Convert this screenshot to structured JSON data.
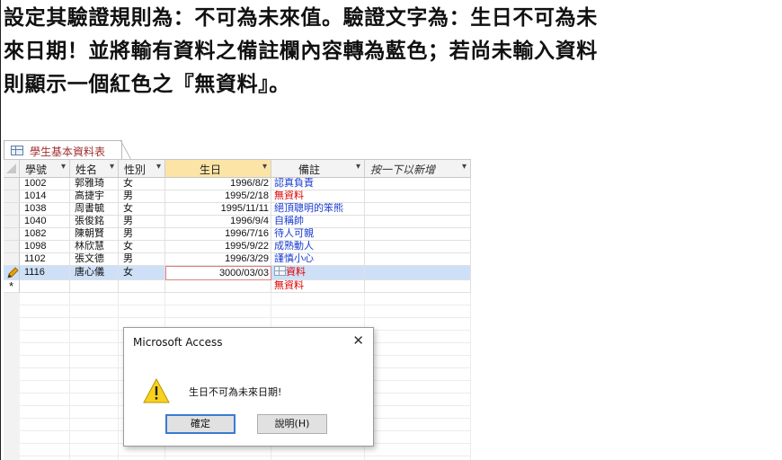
{
  "instruction": {
    "lines": [
      "設定其驗證規則為：不可為未來值。驗證文字為：生日不可為未",
      "來日期！並將輸有資料之備註欄內容轉為藍色；若尚未輸入資料",
      "則顯示一個紅色之『無資料』。"
    ]
  },
  "table": {
    "tab_label": "學生基本資料表",
    "columns": [
      {
        "label": "學號"
      },
      {
        "label": "姓名"
      },
      {
        "label": "性別"
      },
      {
        "label": "生日"
      },
      {
        "label": "備註"
      },
      {
        "label": "按一下以新增"
      }
    ],
    "rows": [
      {
        "id": "1002",
        "name": "郭雅琦",
        "sex": "女",
        "birthday": "1996/8/2",
        "note": "認真負責"
      },
      {
        "id": "1014",
        "name": "高捷宇",
        "sex": "男",
        "birthday": "1995/2/18",
        "note": "無資料"
      },
      {
        "id": "1038",
        "name": "周書毓",
        "sex": "女",
        "birthday": "1995/11/11",
        "note": "絕頂聰明的笨熊"
      },
      {
        "id": "1040",
        "name": "張俊銘",
        "sex": "男",
        "birthday": "1996/9/4",
        "note": "自稱帥"
      },
      {
        "id": "1082",
        "name": "陳朝賢",
        "sex": "男",
        "birthday": "1996/7/16",
        "note": "待人可親"
      },
      {
        "id": "1098",
        "name": "林欣慧",
        "sex": "女",
        "birthday": "1995/9/22",
        "note": "成熟動人"
      },
      {
        "id": "1102",
        "name": "張文德",
        "sex": "男",
        "birthday": "1996/3/29",
        "note": "謹慎小心"
      },
      {
        "id": "1116",
        "name": "唐心儀",
        "sex": "女",
        "birthday": "3000/03/03",
        "note": "資料"
      }
    ],
    "new_row_note": "無資料",
    "active_row_marker": "pencil-icon",
    "new_row_marker": "*"
  },
  "dialog": {
    "title": "Microsoft Access",
    "close": "✕",
    "message": "生日不可為未來日期!",
    "ok_label": "確定",
    "help_label": "說明(H)",
    "icon": "warning-icon"
  },
  "colors": {
    "note_text": "#1a3bd0",
    "no_data_text": "#e00000",
    "selected_header": "#fce4a6",
    "active_row": "#cde0f7",
    "tab_label": "#a03030"
  }
}
